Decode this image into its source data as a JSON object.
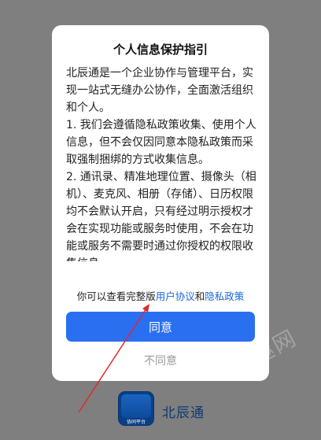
{
  "dialog": {
    "title": "个人信息保护指引",
    "paragraphs": [
      "北辰通是一个企业协作与管理平台，实现一站式无缝办公协作，全面激活组织和个人。",
      "1. 我们会遵循隐私政策收集、使用个人信息，但不会仅因同意本隐私政策而采取强制捆绑的方式收集信息。",
      "2. 通讯录、精准地理位置、摄像头（相机）、麦克风、相册（存储）、日历权限均不会默认开启，只有经过明示授权才会在实现功能或服务时使用，不会在功能或服务不需要时通过你授权的权限收集信息。"
    ],
    "links_prefix": "你可以查看完整版",
    "user_agreement_link": "用户协议",
    "links_and": "和",
    "privacy_policy_link": "隐私政策",
    "agree_label": "同意",
    "disagree_label": "不同意"
  },
  "background": {
    "app_name": "北辰通",
    "logo_text": "协同平台",
    "watermark": "趣网"
  },
  "colors": {
    "overlay": "#7f7f7f",
    "primary_button": "#2a6ff0",
    "link": "#1a66e0",
    "annotation_arrow": "#e0292b"
  }
}
